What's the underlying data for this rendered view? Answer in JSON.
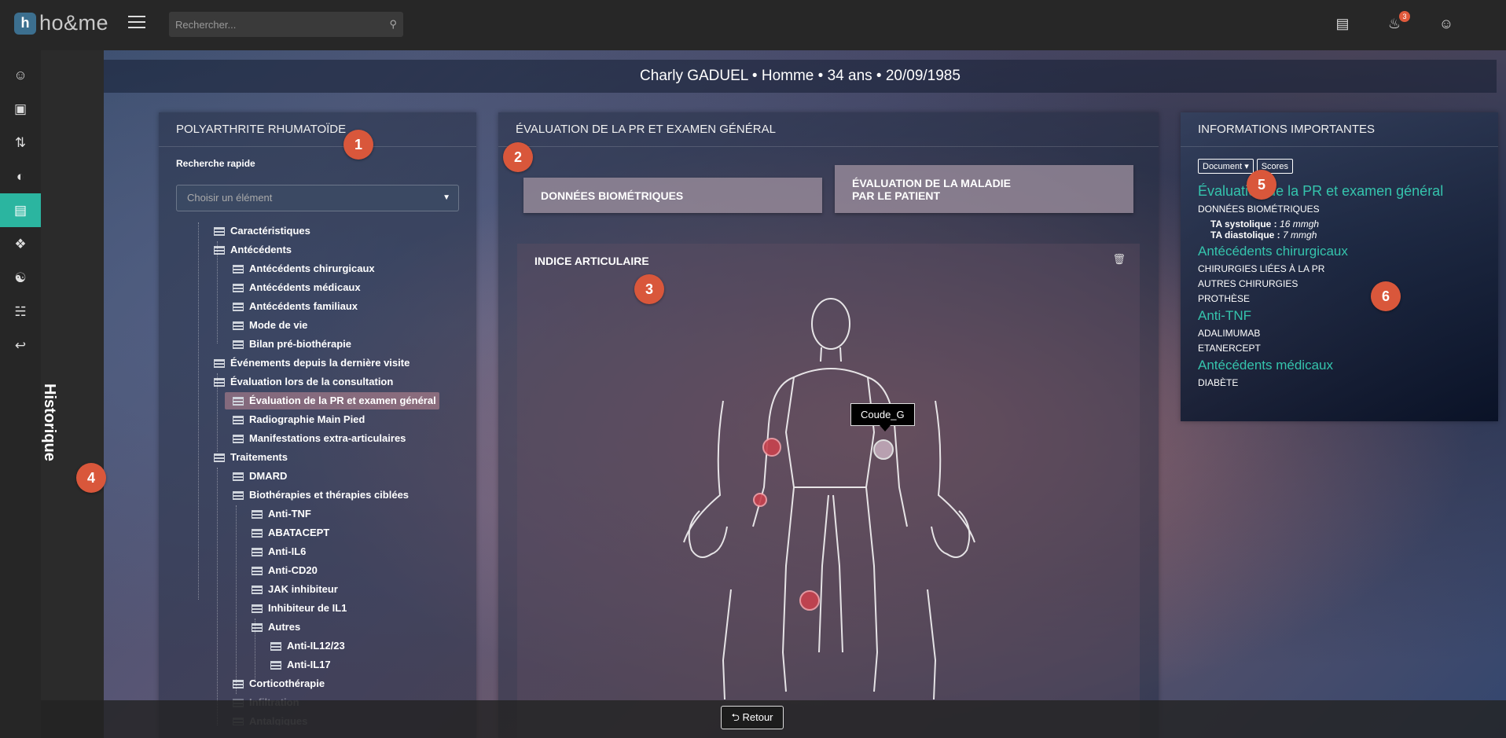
{
  "app": {
    "logo_text": "ho&me",
    "logo_mark": "h"
  },
  "search": {
    "placeholder": "Rechercher..."
  },
  "notifications": {
    "count": "3"
  },
  "patient": {
    "header": "Charly GADUEL • Homme • 34 ans • 20/09/1985"
  },
  "historique": {
    "label": "Historique"
  },
  "left_panel": {
    "title": "POLYARTHRITE RHUMATOÏDE",
    "quick_search_label": "Recherche rapide",
    "select_placeholder": "Choisir un élément",
    "tree": [
      {
        "label": "Caractéristiques",
        "level": 1
      },
      {
        "label": "Antécédents",
        "level": 1
      },
      {
        "label": "Antécédents chirurgicaux",
        "level": 2
      },
      {
        "label": "Antécédents médicaux",
        "level": 2
      },
      {
        "label": "Antécédents familiaux",
        "level": 2
      },
      {
        "label": "Mode de vie",
        "level": 2
      },
      {
        "label": "Bilan pré-biothérapie",
        "level": 2
      },
      {
        "label": "Événements depuis la dernière visite",
        "level": 1
      },
      {
        "label": "Évaluation lors de la consultation",
        "level": 1
      },
      {
        "label": "Évaluation de la PR et examen général",
        "level": 2,
        "selected": true
      },
      {
        "label": "Radiographie Main Pied",
        "level": 2
      },
      {
        "label": "Manifestations extra-articulaires",
        "level": 2
      },
      {
        "label": "Traitements",
        "level": 1
      },
      {
        "label": "DMARD",
        "level": 2
      },
      {
        "label": "Biothérapies et thérapies ciblées",
        "level": 2
      },
      {
        "label": "Anti-TNF",
        "level": 3
      },
      {
        "label": "ABATACEPT",
        "level": 3
      },
      {
        "label": "Anti-IL6",
        "level": 3
      },
      {
        "label": "Anti-CD20",
        "level": 3
      },
      {
        "label": "JAK inhibiteur",
        "level": 3
      },
      {
        "label": "Inhibiteur de IL1",
        "level": 3
      },
      {
        "label": "Autres",
        "level": 3
      },
      {
        "label": "Anti-IL12/23",
        "level": 4
      },
      {
        "label": "Anti-IL17",
        "level": 4
      },
      {
        "label": "Corticothérapie",
        "level": 2
      },
      {
        "label": "Infiltration",
        "level": 2,
        "faded": true
      },
      {
        "label": "Antalgiques",
        "level": 2,
        "faded": true
      }
    ]
  },
  "middle_panel": {
    "title": "ÉVALUATION DE LA PR ET EXAMEN GÉNÉRAL",
    "btn_biometric": "DONNÉES BIOMÉTRIQUES",
    "btn_patient_eval": "ÉVALUATION DE LA MALADIE PAR LE PATIENT",
    "joint_index_title": "INDICE ARTICULAIRE",
    "tooltip": "Coude_G"
  },
  "right_panel": {
    "title": "INFORMATIONS IMPORTANTES",
    "btn_document": "Document",
    "btn_scores": "Scores",
    "section1_title": "Évaluation de la PR et examen général",
    "section1_sub": "DONNÉES BIOMÉTRIQUES",
    "ta_sys_label": "TA systolique :",
    "ta_sys_value": "16 mmgh",
    "ta_dia_label": "TA diastolique :",
    "ta_dia_value": "7 mmgh",
    "section2_title": "Antécédents chirurgicaux",
    "section2_items": [
      "CHIRURGIES LIÉES À LA PR",
      "AUTRES CHIRURGIES",
      "PROTHÈSE"
    ],
    "section3_title": "Anti-TNF",
    "section3_items": [
      "ADALIMUMAB",
      "ETANERCEPT"
    ],
    "section4_title": "Antécédents médicaux",
    "section4_items": [
      "DIABÈTE"
    ]
  },
  "markers": [
    "1",
    "2",
    "3",
    "4",
    "5",
    "6"
  ],
  "bottom": {
    "back_label": "⮌ Retour"
  },
  "colors": {
    "accent": "#2bb5a0",
    "marker": "#d9573b",
    "heading_teal": "#35c4ad"
  }
}
